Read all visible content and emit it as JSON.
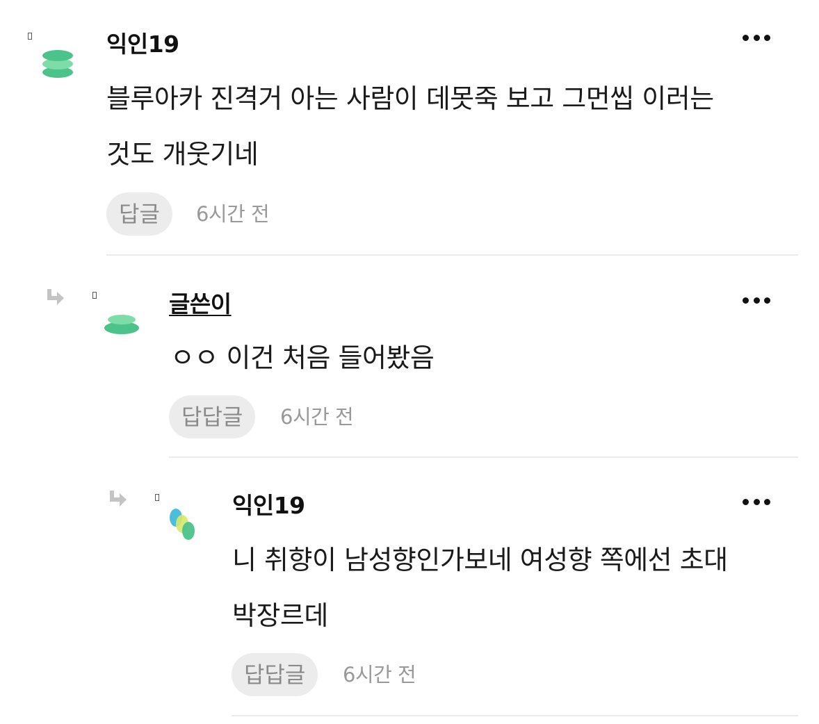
{
  "comments": [
    {
      "author": "익인19",
      "is_writer": false,
      "text_lines": [
        "블루아카 진격거 아는 사람이 데못죽 보고 그먼씹 이러는",
        "것도 개웃기네"
      ],
      "reply_label": "답글",
      "time": "6시간 전",
      "depth": 0
    },
    {
      "author": "글쓴이",
      "is_writer": true,
      "text_lines": [
        "ㅇㅇ 이건 처음 들어봤음"
      ],
      "reply_label": "답답글",
      "time": "6시간 전",
      "depth": 1
    },
    {
      "author": "익인19",
      "is_writer": false,
      "text_lines": [
        "니 취향이 남성향인가보네 여성향 쪽에선 초대",
        "박장르데"
      ],
      "reply_label": "답답글",
      "time": "6시간 전",
      "depth": 2
    }
  ],
  "colors": {
    "avatar_green": "#4cc38a",
    "avatar_light_green": "#7ddca8",
    "avatar_cyan": "#38b6d6",
    "avatar_yellow": "#d8e86a",
    "reply_button_bg": "#ececec",
    "time_text": "#999999",
    "divider": "#ebebeb"
  },
  "icons": {
    "more": "more-dots-icon",
    "reply_arrow": "reply-arrow-icon",
    "broken_image": "broken-image-icon"
  }
}
